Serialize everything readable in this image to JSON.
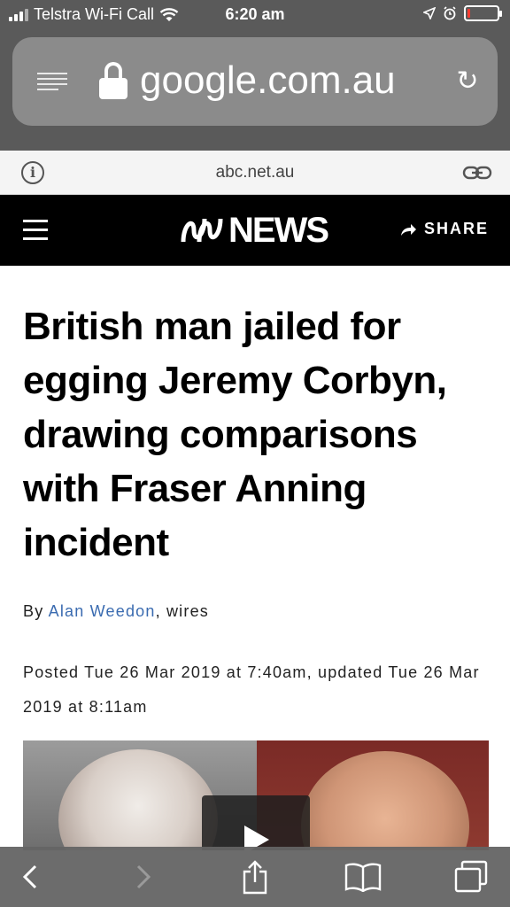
{
  "status": {
    "carrier": "Telstra Wi-Fi Call",
    "time": "6:20 am",
    "battery_level": 0.08,
    "battery_color": "#ff3b30"
  },
  "browser": {
    "address_text": "google.com.au",
    "site_domain": "abc.net.au",
    "icons": [
      "reader-icon",
      "lock-icon",
      "reload-icon",
      "info-icon",
      "link-icon"
    ]
  },
  "header": {
    "logo_text": "NEWS",
    "share_label": "SHARE",
    "background": "#000000"
  },
  "article": {
    "headline": "British man jailed for egging Jeremy Corbyn, drawing comparisons with Fraser Anning incident",
    "byline_prefix": "By",
    "author": "Alan Weedon",
    "byline_suffix": ", wires",
    "posted": "Posted Tue 26 Mar 2019 at 7:40am, updated Tue 26 Mar 2019 at 8:11am",
    "author_color": "#3a6bb0"
  },
  "toolbar": {
    "icons": [
      "back-icon",
      "forward-icon",
      "share-icon",
      "bookmarks-icon",
      "tabs-icon"
    ]
  }
}
